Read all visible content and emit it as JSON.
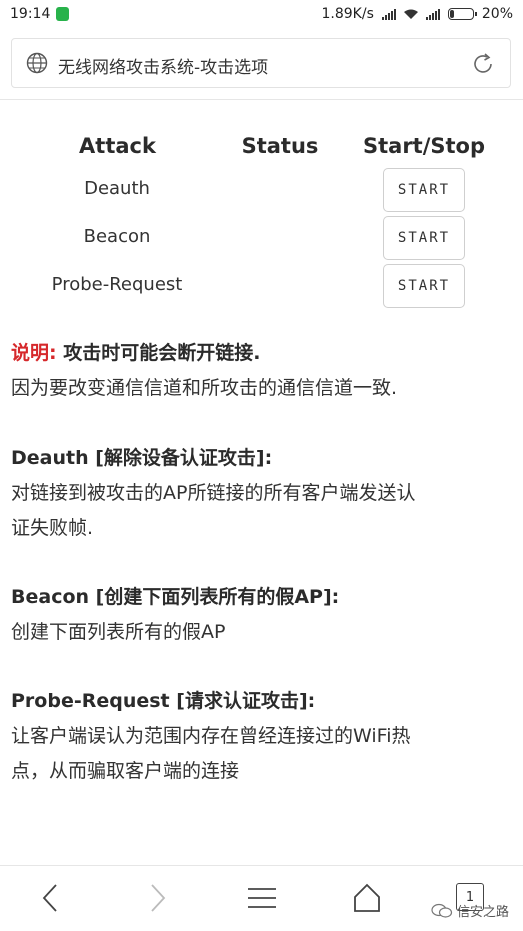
{
  "status_bar": {
    "time": "19:14",
    "net_speed": "1.89K/s",
    "battery": "20%",
    "battery_level": 0.2
  },
  "address_bar": {
    "title": "无线网络攻击系统-攻击选项"
  },
  "attack_table": {
    "headers": [
      "Attack",
      "Status",
      "Start/Stop"
    ],
    "rows": [
      {
        "name": "Deauth",
        "status": "",
        "button": "START"
      },
      {
        "name": "Beacon",
        "status": "",
        "button": "START"
      },
      {
        "name": "Probe-Request",
        "status": "",
        "button": "START"
      }
    ]
  },
  "notes": {
    "warning_label": "说明:",
    "warning_text": " 攻击时可能会断开链接.",
    "warning_detail": "因为要改变通信信道和所攻击的通信信道一致.",
    "deauth_title": "Deauth [解除设备认证攻击]:",
    "deauth_desc_1": "对链接到被攻击的AP所链接的所有客户端发送认",
    "deauth_desc_2": "证失败帧.",
    "beacon_title": "Beacon [创建下面列表所有的假AP]:",
    "beacon_desc": "创建下面列表所有的假AP",
    "probe_title": "Probe-Request [请求认证攻击]:",
    "probe_desc_1": "让客户端误认为范围内存在曾经连接过的WiFi热",
    "probe_desc_2": "点，从而骗取客户端的连接"
  },
  "bottom_nav": {
    "tab_count": "1",
    "watermark": "信安之路"
  },
  "colors": {
    "accent_red": "#d6282b",
    "shield_green": "#28b24b"
  }
}
